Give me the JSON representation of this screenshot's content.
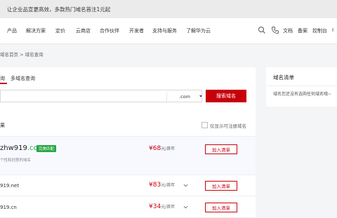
{
  "promo": {
    "text": "让企业品宣更高效，多款热门域名首注1元起"
  },
  "nav": {
    "items": [
      "产品",
      "解决方案",
      "定价",
      "云商店",
      "合作伙伴",
      "开发者",
      "支持与服务",
      "了解华为云"
    ],
    "right": {
      "docs": "文档",
      "filing": "备案",
      "console": "控制台",
      "last": "I"
    }
  },
  "breadcrumb": {
    "home": "域名首页",
    "sep": ">",
    "current": "域名查询"
  },
  "search": {
    "tabs": {
      "single": "询",
      "multi": "多域名查询"
    },
    "value": "",
    "suffix": ".com",
    "button": "搜索域名"
  },
  "results": {
    "heading": "果",
    "filter_label": "仅显示可注册域名",
    "featured": {
      "domain_name": "zhw919",
      "domain_suffix": ".com",
      "badge": "完美匹配",
      "desc": "个性和创意的域名",
      "price": "¥68",
      "unit": "元/首年",
      "button": "加入清单"
    },
    "rows": [
      {
        "domain": "919.net",
        "price": "¥83",
        "unit": "元/首年",
        "button": "加入清单"
      },
      {
        "domain": "919.cn",
        "price": "¥34",
        "unit": "元/首年",
        "button": "加入清单"
      }
    ]
  },
  "cart": {
    "title": "域名清单",
    "empty": "域名您还没有选购任何域名哦~"
  },
  "colors": {
    "accent": "#c7000b",
    "success": "#28a745",
    "background": "#f4f5f7"
  }
}
